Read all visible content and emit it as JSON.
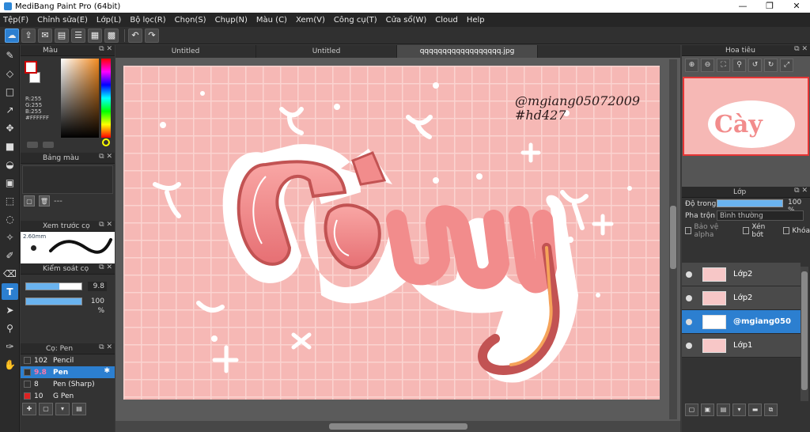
{
  "window": {
    "title": "MediBang Paint Pro (64bit)",
    "minimize": "—",
    "maximize": "❐",
    "close": "✕"
  },
  "menu": [
    "Tệp(F)",
    "Chỉnh sửa(E)",
    "Lớp(L)",
    "Bộ lọc(R)",
    "Chọn(S)",
    "Chụp(N)",
    "Màu (C)",
    "Xem(V)",
    "Công cụ(T)",
    "Cửa sổ(W)",
    "Cloud",
    "Help"
  ],
  "panels": {
    "color": {
      "title": "Màu",
      "r": "R:255",
      "g": "G:255",
      "b": "B:255",
      "hex": "#FFFFFF"
    },
    "palette": {
      "title": "Bảng màu",
      "dash": "---"
    },
    "brush_preview": {
      "title": "Xem trước cọ",
      "size": "2.60mm"
    },
    "brush_control": {
      "title": "Kiểm soát cọ",
      "size_value": "9.8",
      "opacity_value": "100 %",
      "size_fraction": 0.6,
      "opacity_fraction": 1.0
    },
    "brushes": {
      "title": "Cọ: Pen",
      "items": [
        {
          "num": "102",
          "name": "Pencil",
          "color": "#333333"
        },
        {
          "num": "9.8",
          "name": "Pen",
          "color": "#333333"
        },
        {
          "num": "8",
          "name": "Pen (Sharp)",
          "color": "#333333"
        },
        {
          "num": "10",
          "name": "G Pen",
          "color": "#dd2222"
        }
      ]
    },
    "navigator": {
      "title": "Hoa tiêu"
    },
    "layer": {
      "title": "Lớp",
      "opacity_label": "Độ trong",
      "opacity_value": "100 %",
      "opacity_fraction": 1.0,
      "blend_label": "Pha trộn",
      "blend_value": "Bình thường",
      "protect_alpha": "Bảo vệ alpha",
      "clip": "Xén bớt",
      "lock": "Khóa",
      "layers": [
        {
          "name": "Lớp2",
          "selected": false
        },
        {
          "name": "Lớp2",
          "selected": false
        },
        {
          "name": "@mgiang050",
          "selected": true
        },
        {
          "name": "Lớp1",
          "selected": false
        }
      ]
    }
  },
  "tabs": [
    "Untitled",
    "Untitled",
    "qqqqqqqqqqqqqqqqqq.jpg"
  ],
  "artwork": {
    "text": "Cày",
    "handle": "@mgiang05072009",
    "tag": "#hd427",
    "background": "#f8b9b6",
    "colors": {
      "letters": "#f28c8c",
      "outline": "#ffffff",
      "shadow": "#c25353",
      "accent": "#f5a35a"
    }
  },
  "tools_icons": [
    "brush-icon",
    "eraser-icon",
    "rect-icon",
    "pen-icon",
    "move-icon",
    "fill-square-icon",
    "bucket-icon",
    "gradient-icon",
    "select-rect-icon",
    "lasso-icon",
    "magic-wand-icon",
    "select-pen-icon",
    "select-eraser-icon",
    "text-icon",
    "operation-icon",
    "eyedropper-icon",
    "dropper-icon",
    "hand-icon"
  ]
}
